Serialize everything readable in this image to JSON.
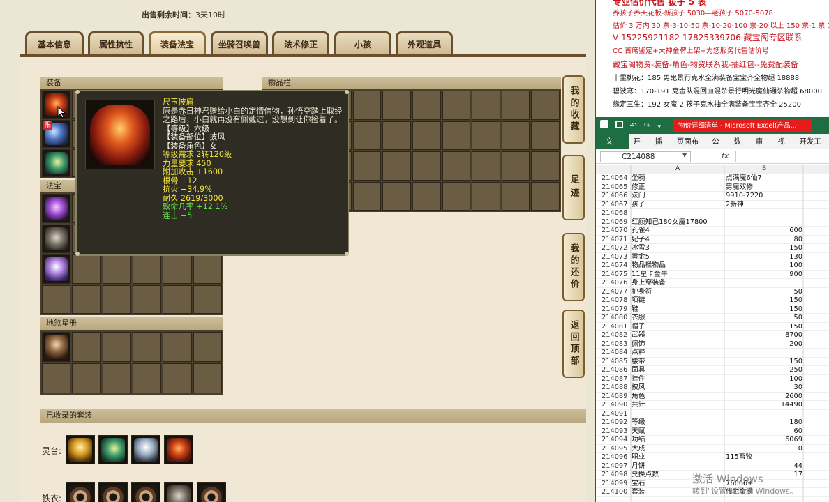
{
  "sale": {
    "label": "出售剩余时间：",
    "value": "3天10时"
  },
  "tabs": [
    "基本信息",
    "属性抗性",
    "装备法宝",
    "坐骑召唤兽",
    "法术修正",
    "小孩",
    "外观道具"
  ],
  "sections": {
    "equip": "装备",
    "inventory": "物品栏",
    "fabao": "法宝",
    "lingbao": "地煞星册",
    "suits": "已收录的套装"
  },
  "side_nav": [
    "我的收藏",
    "足迹",
    "我的还价",
    "返回顶部"
  ],
  "tags": {
    "xian": "限"
  },
  "tooltip": {
    "name": "尺玉披肩",
    "desc": "原是赤日神君赠给小白的定情信物，孙悟空踏上取经之路后，小白就再没有佩戴过，没想到让你捡着了。",
    "lines_white": [
      "【等级】六级",
      "【装备部位】披风",
      "【装备角色】女"
    ],
    "lines_yellow": [
      "等级需求 2转120级",
      "力量要求 450",
      "附加攻击 +1600",
      "根骨 +12",
      "抗火 +34.9%",
      "耐久 2619/3000"
    ],
    "lines_green": [
      "致命几率 +12.1%",
      "连击 +5"
    ]
  },
  "suit_rows": [
    {
      "label": "灵台:"
    },
    {
      "label": "铁衣:"
    }
  ],
  "doc": {
    "line0": "专业估价代售 拔子 5 表",
    "line1": "养孩子养天花板-新孩子 5030—老孩子 5070-5078",
    "line2": "估价 3 万内 30 票-3-10-50 票-10-20-100 票-20 以上 150 票-1 票 1",
    "line3": "V 15225921182    17825339706 藏宝阁专区联系",
    "line4": "CC 首席鉴定+大神金牌上架+为您服务代售估价号",
    "line5": "藏宝阁物资-装备-角色-物资联系我-抽红包--免费配装备",
    "line6": "十里桃花：185 男鬼景行克水全满装备宝宝齐全物超 18888",
    "line7": "碧波寒：170-191 克金队混回血混杀景行明光魔仙通杀物超 68000",
    "line8": "缘定三生：192 女魔 2 孩子克水抽全满装备宝宝齐全 25200"
  },
  "excel": {
    "title": "物价详细清单 - Microsoft Excel(产品...",
    "menus": [
      "文件",
      "开始",
      "插入",
      "页面布局",
      "公式",
      "数据",
      "审阅",
      "视图",
      "开发工具"
    ],
    "namebox": "C214088",
    "fx": "fx",
    "col_a": "A",
    "col_b": "B",
    "rows": [
      [
        "214064",
        "坐骑",
        "点满魔6仙7"
      ],
      [
        "214065",
        "修正",
        "男魔双修"
      ],
      [
        "214066",
        "法门",
        "9910-7220"
      ],
      [
        "214067",
        "孩子",
        "2新神"
      ],
      [
        "214068",
        "",
        ""
      ],
      [
        "214069",
        "红颜知己180女魔17800",
        ""
      ],
      [
        "214070",
        "孔雀4",
        "600"
      ],
      [
        "214071",
        "妃子4",
        "80"
      ],
      [
        "214072",
        "冰雪3",
        "150"
      ],
      [
        "214073",
        "黄金5",
        "130"
      ],
      [
        "214074",
        "物品栏物品",
        "100"
      ],
      [
        "214075",
        "11星卡金牛",
        "900"
      ],
      [
        "214076",
        "身上穿装备",
        ""
      ],
      [
        "214077",
        "护身符",
        "50"
      ],
      [
        "214078",
        "项链",
        "150"
      ],
      [
        "214079",
        "鞋",
        "150"
      ],
      [
        "214080",
        "衣服",
        "50"
      ],
      [
        "214081",
        "帽子",
        "150"
      ],
      [
        "214082",
        "武器",
        "8700"
      ],
      [
        "214083",
        "佩饰",
        "200"
      ],
      [
        "214084",
        "点粹",
        ""
      ],
      [
        "214085",
        "腰带",
        "150"
      ],
      [
        "214086",
        "面具",
        "250"
      ],
      [
        "214087",
        "挂件",
        "100"
      ],
      [
        "214088",
        "披风",
        "30"
      ],
      [
        "214089",
        "角色",
        "2600"
      ],
      [
        "214090",
        "共计",
        "14490"
      ],
      [
        "214091",
        "",
        ""
      ],
      [
        "214092",
        "等级",
        "180"
      ],
      [
        "214093",
        "天赋",
        "60"
      ],
      [
        "214094",
        "功绩",
        "6069"
      ],
      [
        "214095",
        "大成",
        "0"
      ],
      [
        "214096",
        "职业",
        "115畜牧"
      ],
      [
        "214097",
        "月饼",
        "44"
      ],
      [
        "214098",
        "兑换点数",
        "17"
      ],
      [
        "214099",
        "宝石",
        "76666+"
      ],
      [
        "214100",
        "套装",
        "传世金阙"
      ]
    ],
    "watermark_title": "激活 Windows",
    "watermark_sub": "转到\"设置\"以激活 Windows。"
  },
  "colors": {
    "excel_green": "#1f6e43",
    "red_text": "#c8151d",
    "tooltip_bg": "#2f2d23"
  }
}
